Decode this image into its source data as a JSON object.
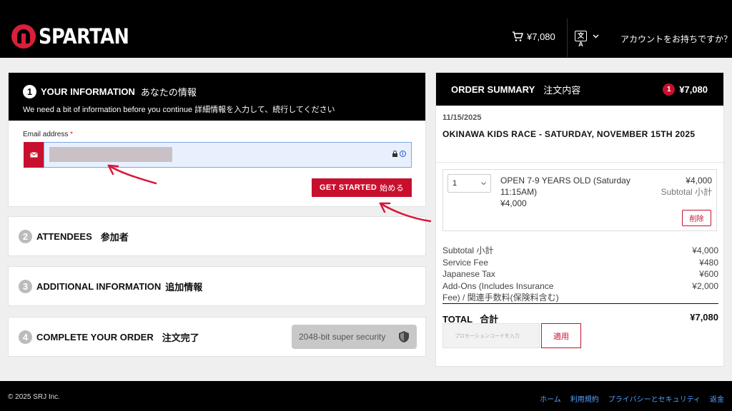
{
  "header": {
    "brand": "SPARTAN",
    "cart_total": "¥7,080",
    "account_link": "アカウントをお持ちですか？"
  },
  "step1": {
    "number": "1",
    "title": "YOUR INFORMATION",
    "title_ja": "あなたの情報",
    "subtitle": "We need a bit of information before you continue 詳細情報を入力して、続行してください",
    "email_label": "Email address",
    "required_mark": "*",
    "get_started": "GET STARTED",
    "get_started_ja": "始める"
  },
  "steps": [
    {
      "number": "2",
      "title": "ATTENDEES",
      "title_ja": "参加者"
    },
    {
      "number": "3",
      "title": "ADDITIONAL INFORMATION",
      "title_ja": "追加情報"
    },
    {
      "number": "4",
      "title": "COMPLETE YOUR ORDER",
      "title_ja": "注文完了"
    }
  ],
  "security_badge": "2048-bit super security",
  "summary": {
    "title": "ORDER SUMMARY",
    "title_ja": "注文内容",
    "item_count": "1",
    "total": "¥7,080",
    "event_date": "11/15/2025",
    "event_name": "OKINAWA KIDS RACE - SATURDAY, NOVEMBER 15TH 2025",
    "item": {
      "quantity": "1",
      "name": "OPEN 7-9 YEARS OLD (Saturday 11:15AM)",
      "unit_price": "¥4,000",
      "price": "¥4,000",
      "subtotal_label": "Subtotal 小計",
      "delete_label": "削除"
    },
    "totals": [
      {
        "label": "Subtotal 小計",
        "value": "¥4,000"
      },
      {
        "label": "Service Fee",
        "value": "¥480"
      },
      {
        "label": "Japanese Tax",
        "value": "¥600"
      },
      {
        "label": "Add-Ons (Includes Insurance Fee) / 関連手数料(保険料含む)",
        "value": "¥2,000"
      }
    ],
    "grand_total_label": "TOTAL",
    "grand_total_label_ja": "合計",
    "grand_total": "¥7,080",
    "promo_placeholder": "プロモーションコードを入力",
    "apply_label": "適用"
  },
  "footer": {
    "copyright": "© 2025 SRJ Inc.",
    "links": [
      "ホーム",
      "利用規約",
      "プライバシーとセキュリティ",
      "返金"
    ]
  },
  "colors": {
    "brand_red": "#c8102e",
    "header_bg": "#000000",
    "link_blue": "#5aa0ff"
  }
}
